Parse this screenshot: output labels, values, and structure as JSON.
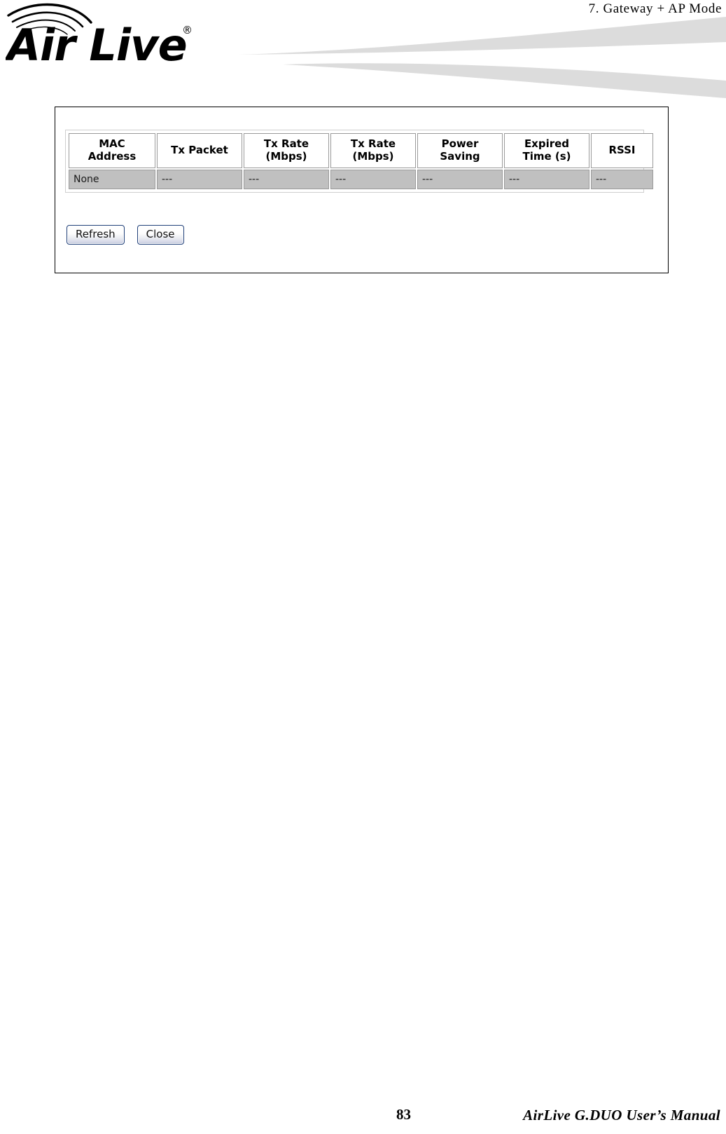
{
  "header": {
    "chapter_title": "7.  Gateway  +  AP   Mode",
    "logo": {
      "name": "airlive-logo",
      "wordmark_air": "Air",
      "wordmark_live": "Live",
      "registered_mark": "®"
    },
    "swoosh_color": "#dcdcdc"
  },
  "panel": {
    "name": "station-list-window",
    "border_color": "#000000",
    "background": "#ffffff"
  },
  "table": {
    "columns": [
      {
        "id": "mac-address",
        "label_line1": "MAC",
        "label_line2": "Address"
      },
      {
        "id": "tx-packet",
        "label_line1": "Tx Packet",
        "label_line2": ""
      },
      {
        "id": "tx-rate-1",
        "label_line1": "Tx Rate",
        "label_line2": "(Mbps)"
      },
      {
        "id": "tx-rate-2",
        "label_line1": "Tx Rate",
        "label_line2": "(Mbps)"
      },
      {
        "id": "power-saving",
        "label_line1": "Power",
        "label_line2": "Saving"
      },
      {
        "id": "expired-time",
        "label_line1": "Expired",
        "label_line2": "Time (s)"
      },
      {
        "id": "rssi",
        "label_line1": "RSSI",
        "label_line2": ""
      }
    ],
    "rows": [
      {
        "mac_address": "None",
        "tx_packet": "---",
        "tx_rate_1": "---",
        "tx_rate_2": "---",
        "power_saving": "---",
        "expired_time": "---",
        "rssi": "---"
      }
    ],
    "header_background": "#ffffff",
    "row_background": "#c0c0c0",
    "cell_border_color": "#9a9a9a"
  },
  "buttons": {
    "refresh_label": "Refresh",
    "close_label": "Close",
    "border_color": "#1f3f78"
  },
  "footer": {
    "page_number": "83",
    "manual_title": "AirLive  G.DUO  User’s  Manual"
  }
}
